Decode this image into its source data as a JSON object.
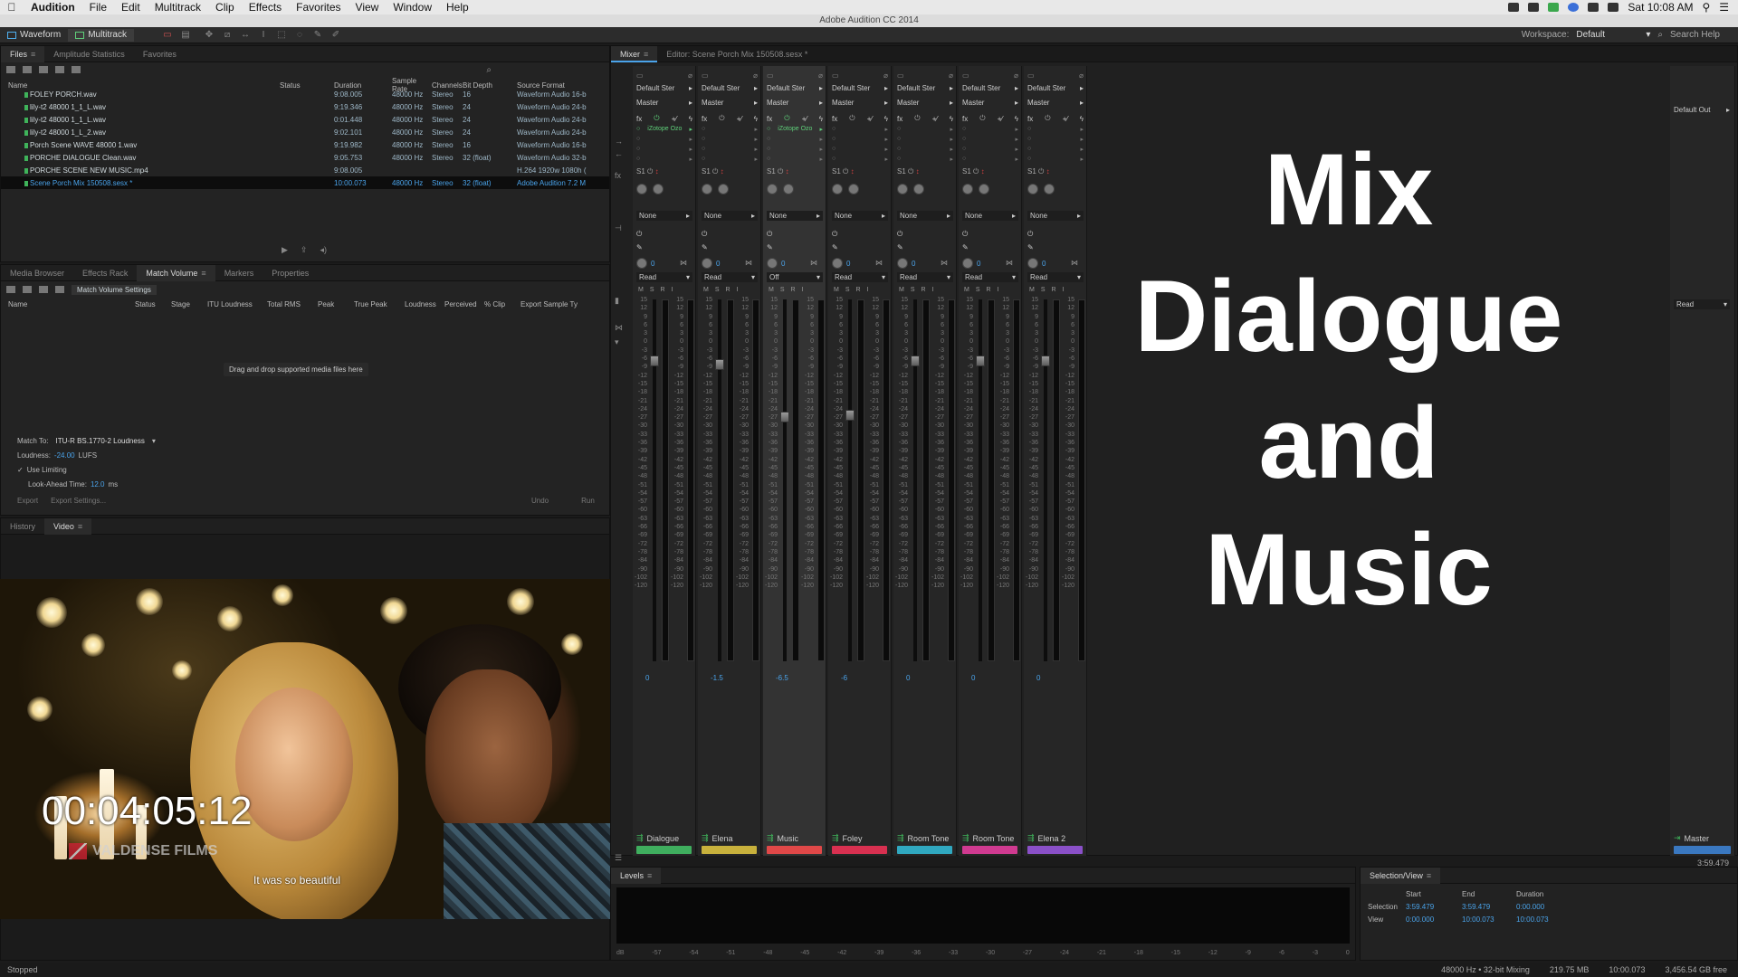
{
  "menubar": {
    "app": "Audition",
    "items": [
      "File",
      "Edit",
      "Multitrack",
      "Clip",
      "Effects",
      "Favorites",
      "View",
      "Window",
      "Help"
    ],
    "clock": "Sat 10:08 AM"
  },
  "window_title": "Adobe Audition CC 2014",
  "toolbar": {
    "waveform": "Waveform",
    "multitrack": "Multitrack",
    "workspace_label": "Workspace:",
    "workspace_value": "Default",
    "search_help": "Search Help"
  },
  "files_panel": {
    "tabs": [
      "Files",
      "Amplitude Statistics",
      "Favorites"
    ],
    "columns": [
      "Name",
      "Status",
      "Duration",
      "Sample Rate",
      "Channels",
      "Bit Depth",
      "Source Format"
    ],
    "rows": [
      {
        "name": "FOLEY PORCH.wav",
        "status": "",
        "duration": "9:08.005",
        "rate": "48000 Hz",
        "channels": "Stereo",
        "depth": "16",
        "format": "Waveform Audio 16-b"
      },
      {
        "name": "lily-t2 48000 1_1_L.wav",
        "status": "",
        "duration": "9:19.346",
        "rate": "48000 Hz",
        "channels": "Stereo",
        "depth": "24",
        "format": "Waveform Audio 24-b"
      },
      {
        "name": "lily-t2 48000 1_1_L.wav",
        "status": "",
        "duration": "0:01.448",
        "rate": "48000 Hz",
        "channels": "Stereo",
        "depth": "24",
        "format": "Waveform Audio 24-b"
      },
      {
        "name": "lily-t2 48000 1_L_2.wav",
        "status": "",
        "duration": "9:02.101",
        "rate": "48000 Hz",
        "channels": "Stereo",
        "depth": "24",
        "format": "Waveform Audio 24-b"
      },
      {
        "name": "Porch Scene WAVE 48000 1.wav",
        "status": "",
        "duration": "9:19.982",
        "rate": "48000 Hz",
        "channels": "Stereo",
        "depth": "16",
        "format": "Waveform Audio 16-b"
      },
      {
        "name": "PORCHE DIALOGUE Clean.wav",
        "status": "",
        "duration": "9:05.753",
        "rate": "48000 Hz",
        "channels": "Stereo",
        "depth": "32 (float)",
        "format": "Waveform Audio 32-b"
      },
      {
        "name": "PORCHE SCENE NEW MUSIC.mp4",
        "status": "",
        "duration": "9:08.005",
        "rate": "",
        "channels": "",
        "depth": "",
        "format": "H.264 1920w 1080h ("
      },
      {
        "name": "Scene Porch Mix 150508.sesx *",
        "status": "",
        "duration": "10:00.073",
        "rate": "48000 Hz",
        "channels": "Stereo",
        "depth": "32 (float)",
        "format": "Adobe Audition 7.2 M",
        "selected": true
      }
    ]
  },
  "match_panel": {
    "tabs": [
      "Media Browser",
      "Effects Rack",
      "Match Volume",
      "Markers",
      "Properties"
    ],
    "settings_button": "Match Volume Settings",
    "columns": [
      "Name",
      "Status",
      "Stage",
      "ITU Loudness",
      "Total RMS",
      "Peak",
      "True Peak",
      "Loudness",
      "Perceived",
      "% Clip",
      "Export Sample Ty"
    ],
    "drop_hint": "Drag and drop supported media files here",
    "match_to_label": "Match To:",
    "match_to_value": "ITU-R BS.1770-2 Loudness",
    "loudness_label": "Loudness:",
    "loudness_value": "-24.00",
    "loudness_unit": "LUFS",
    "use_limiting": "Use Limiting",
    "lookahead_label": "Look-Ahead Time:",
    "lookahead_value": "12.0",
    "lookahead_unit": "ms",
    "export": "Export",
    "export_settings": "Export Settings...",
    "undo": "Undo",
    "run": "Run"
  },
  "video_panel": {
    "tabs": [
      "History",
      "Video"
    ],
    "timecode": "00:04:05:12",
    "watermark": "VALDENSE FILMS",
    "subtitle": "It was so beautiful"
  },
  "mixer": {
    "tabs": [
      "Mixer",
      "Editor: Scene Porch Mix 150508.sesx *"
    ],
    "input": "Default Ster",
    "output": "Master",
    "automation": "Read",
    "send": "None",
    "channel_id": "S1",
    "scale": [
      "15",
      "12",
      "9",
      "6",
      "3",
      "0",
      "-3",
      "-6",
      "-9",
      "-12",
      "-15",
      "-18",
      "-21",
      "-24",
      "-27",
      "-30",
      "-33",
      "-36",
      "-39",
      "-42",
      "-45",
      "-48",
      "-51",
      "-54",
      "-57",
      "-60",
      "-63",
      "-66",
      "-69",
      "-72",
      "-78",
      "-84",
      "-90",
      "-102",
      "-120"
    ],
    "fx_plugin": "iZotope Ozo",
    "master_output": "Default Out",
    "master_automation": "Read",
    "master_label": "Master",
    "master_time": "3:59.479",
    "strips": [
      {
        "name": "Dialogue",
        "volume": "0",
        "automation": "Read",
        "color": "#3fae5e"
      },
      {
        "name": "Elena",
        "volume": "-1.5",
        "automation": "Read",
        "color": "#c8b13c"
      },
      {
        "name": "Music",
        "volume": "-6.5",
        "automation": "Off",
        "color": "#e04848"
      },
      {
        "name": "Foley",
        "volume": "-6",
        "automation": "Read",
        "color": "#d83050"
      },
      {
        "name": "Room Tone",
        "volume": "0",
        "automation": "Read",
        "color": "#30a8c0"
      },
      {
        "name": "Room Tone",
        "volume": "0",
        "automation": "Read",
        "color": "#d03a90"
      },
      {
        "name": "Elena 2",
        "volume": "0",
        "automation": "Read",
        "color": "#8a50c8"
      }
    ]
  },
  "overlay": {
    "line1": "Mix",
    "line2": "Dialogue",
    "line3": "and",
    "line4": "Music"
  },
  "levels_panel": {
    "tab": "Levels",
    "ticks": [
      "dB",
      "-57",
      "-54",
      "-51",
      "-48",
      "-45",
      "-42",
      "-39",
      "-36",
      "-33",
      "-30",
      "-27",
      "-24",
      "-21",
      "-18",
      "-15",
      "-12",
      "-9",
      "-6",
      "-3",
      "0"
    ]
  },
  "selection_view": {
    "tab": "Selection/View",
    "headers": [
      "Start",
      "End",
      "Duration"
    ],
    "selection_label": "Selection",
    "selection": [
      "3:59.479",
      "3:59.479",
      "0:00.000"
    ],
    "view_label": "View",
    "view": [
      "0:00.000",
      "10:00.073",
      "10:00.073"
    ]
  },
  "statusbar": {
    "left": "Stopped",
    "format": "48000 Hz • 32-bit Mixing",
    "memory": "219.75 MB",
    "duration": "10:00.073",
    "free": "3,456.54 GB free"
  }
}
